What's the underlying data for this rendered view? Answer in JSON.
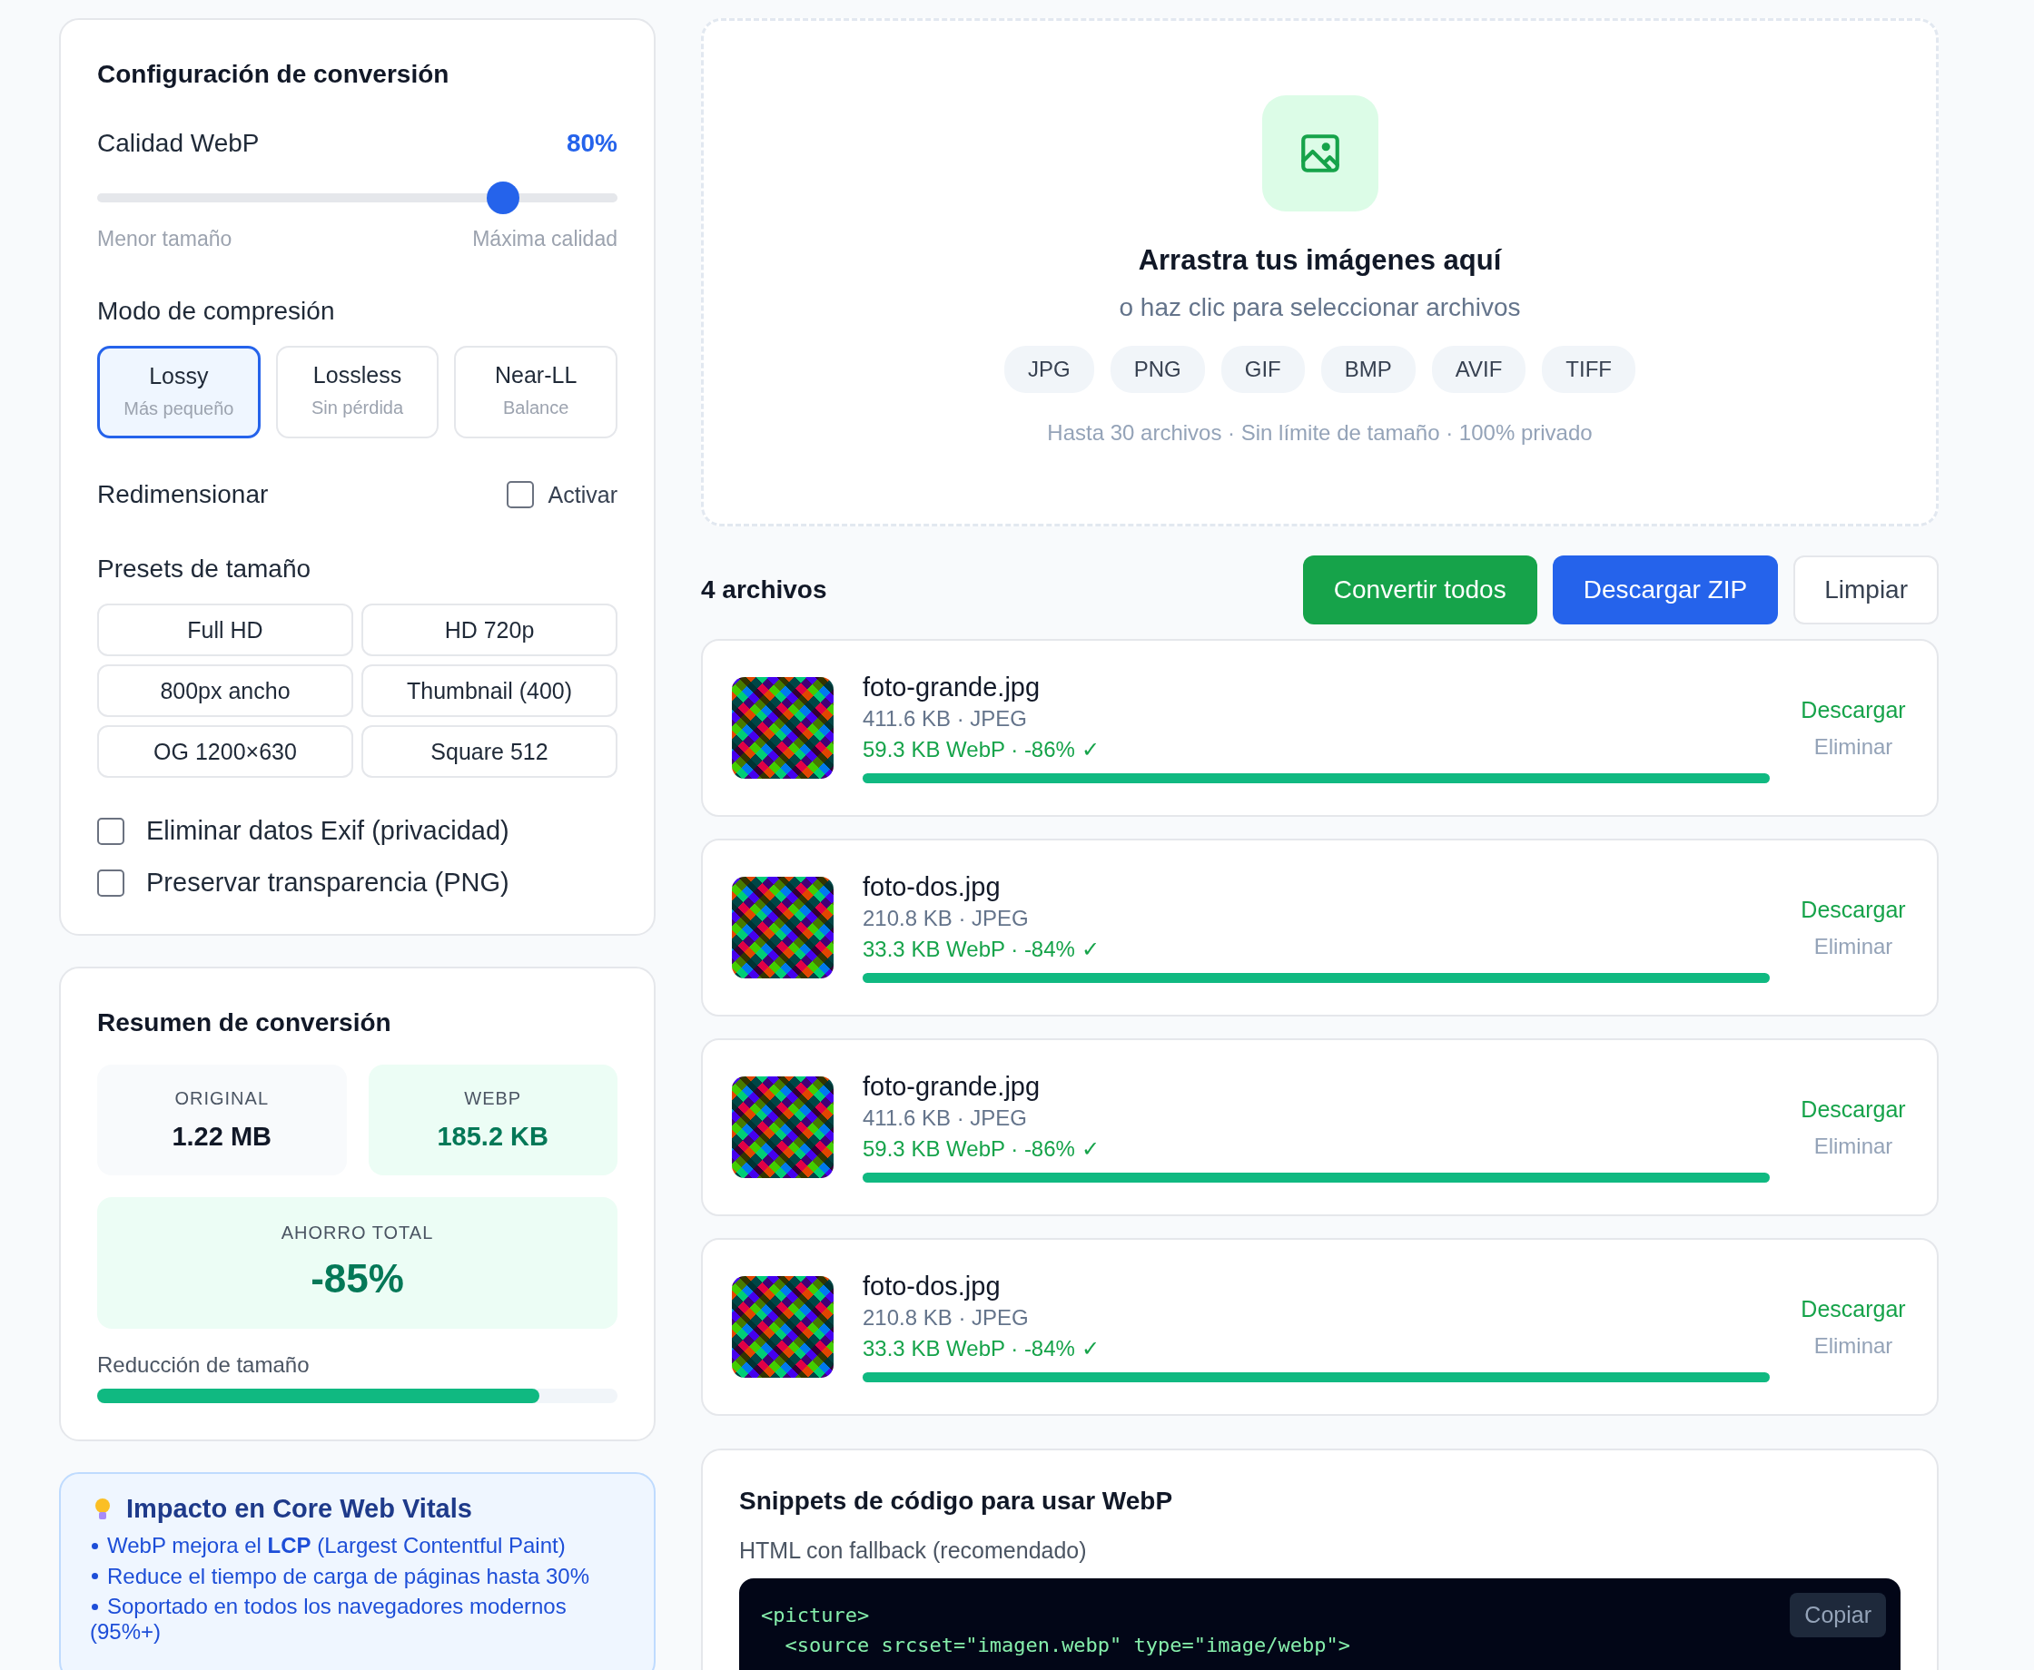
{
  "settings": {
    "title": "Configuración de conversión",
    "quality": {
      "label": "Calidad WebP",
      "value": "80%",
      "level": 0.78,
      "min_label": "Menor tamaño",
      "max_label": "Máxima calidad"
    },
    "compression": {
      "label": "Modo de compresión",
      "modes": [
        {
          "name": "Lossy",
          "hint": "Más pequeño",
          "selected": true
        },
        {
          "name": "Lossless",
          "hint": "Sin pérdida",
          "selected": false
        },
        {
          "name": "Near-LL",
          "hint": "Balance",
          "selected": false
        }
      ]
    },
    "resize": {
      "label": "Redimensionar",
      "toggle_label": "Activar",
      "checked": false
    },
    "presets": {
      "label": "Presets de tamaño",
      "items": [
        "Full HD",
        "HD 720p",
        "800px ancho",
        "Thumbnail (400)",
        "OG 1200×630",
        "Square 512"
      ]
    },
    "options": [
      {
        "label": "Eliminar datos Exif (privacidad)",
        "checked": false
      },
      {
        "label": "Preservar transparencia (PNG)",
        "checked": false
      }
    ]
  },
  "summary": {
    "title": "Resumen de conversión",
    "original": {
      "label": "ORIGINAL",
      "value": "1.22 MB"
    },
    "webp": {
      "label": "WEBP",
      "value": "185.2 KB"
    },
    "saving": {
      "label": "AHORRO TOTAL",
      "value": "-85%"
    },
    "reduction": {
      "label": "Reducción de tamaño",
      "level": 0.85
    }
  },
  "tips": {
    "title": "Impacto en Core Web Vitals",
    "items": [
      "WebP mejora el **LCP** (Largest Contentful Paint)",
      "Reduce el tiempo de carga de páginas hasta 30%",
      "Soportado en todos los navegadores modernos (95%+)"
    ]
  },
  "dropzone": {
    "title": "Arrastra tus imágenes aquí",
    "subtitle": "o haz clic para seleccionar archivos",
    "formats": [
      "JPG",
      "PNG",
      "GIF",
      "BMP",
      "AVIF",
      "TIFF"
    ],
    "note": "Hasta 30 archivos · Sin límite de tamaño · 100% privado"
  },
  "files": {
    "count": "4 archivos",
    "buttons": [
      {
        "label": "Convertir todos",
        "kind": "green"
      },
      {
        "label": "Descargar ZIP",
        "kind": "blue"
      },
      {
        "label": "Limpiar",
        "kind": "plain"
      }
    ],
    "items": [
      {
        "name": "foto-grande.jpg",
        "meta": "411.6 KB · JPEG",
        "result": "59.3 KB WebP · -86% ✓",
        "level": 1,
        "download": "Descargar",
        "remove": "Eliminar"
      },
      {
        "name": "foto-dos.jpg",
        "meta": "210.8 KB · JPEG",
        "result": "33.3 KB WebP · -84% ✓",
        "level": 1,
        "download": "Descargar",
        "remove": "Eliminar"
      },
      {
        "name": "foto-grande.jpg",
        "meta": "411.6 KB · JPEG",
        "result": "59.3 KB WebP · -86% ✓",
        "level": 1,
        "download": "Descargar",
        "remove": "Eliminar"
      },
      {
        "name": "foto-dos.jpg",
        "meta": "210.8 KB · JPEG",
        "result": "33.3 KB WebP · -84% ✓",
        "level": 1,
        "download": "Descargar",
        "remove": "Eliminar"
      }
    ]
  },
  "snippets": {
    "title": "Snippets de código para usar WebP",
    "subtitle": "HTML con fallback (recomendado)",
    "code": [
      "<picture>",
      "  <source srcset=\"imagen.webp\" type=\"image/webp\">"
    ],
    "copy": "Copiar"
  }
}
